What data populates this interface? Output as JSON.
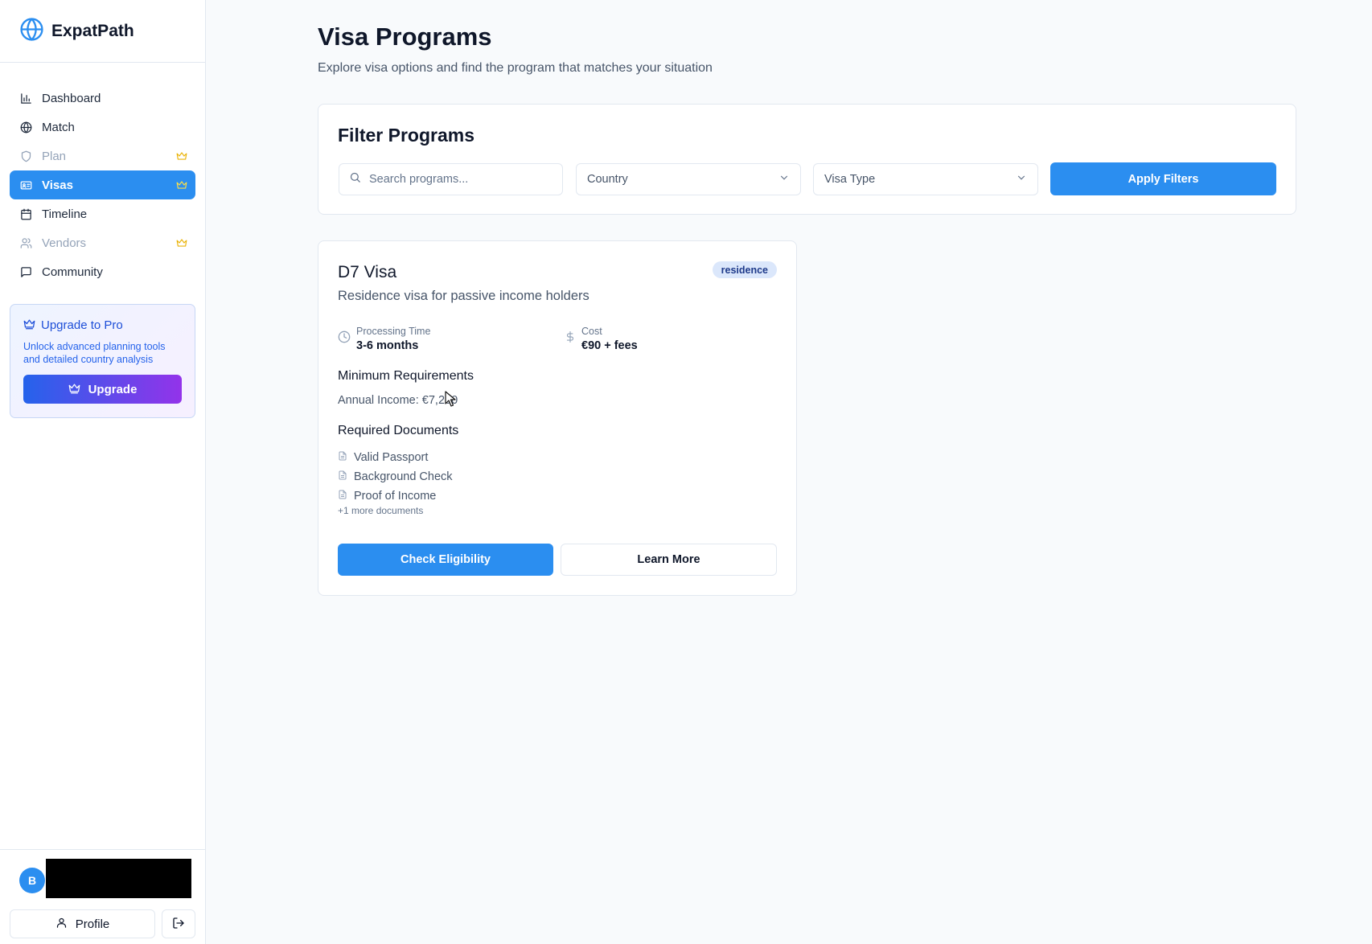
{
  "brand": {
    "name": "ExpatPath",
    "icon": "globe-icon"
  },
  "sidebar": {
    "items": [
      {
        "label": "Dashboard",
        "icon": "bar-chart-icon",
        "state": "normal",
        "premium": false
      },
      {
        "label": "Match",
        "icon": "globe-icon",
        "state": "normal",
        "premium": false
      },
      {
        "label": "Plan",
        "icon": "shield-icon",
        "state": "locked",
        "premium": true
      },
      {
        "label": "Visas",
        "icon": "id-card-icon",
        "state": "active",
        "premium": true
      },
      {
        "label": "Timeline",
        "icon": "calendar-icon",
        "state": "normal",
        "premium": false
      },
      {
        "label": "Vendors",
        "icon": "users-icon",
        "state": "locked",
        "premium": true
      },
      {
        "label": "Community",
        "icon": "message-icon",
        "state": "normal",
        "premium": false
      }
    ],
    "upgrade": {
      "title": "Upgrade to Pro",
      "description": "Unlock advanced planning tools and detailed country analysis",
      "button": "Upgrade"
    },
    "footer": {
      "avatar_initial": "B",
      "profile_label": "Profile"
    }
  },
  "main": {
    "title": "Visa Programs",
    "subtitle": "Explore visa options and find the program that matches your situation",
    "filter": {
      "title": "Filter Programs",
      "search_placeholder": "Search programs...",
      "country_placeholder": "Country",
      "visa_type_placeholder": "Visa Type",
      "apply_label": "Apply Filters"
    },
    "programs": [
      {
        "name": "D7 Visa",
        "badge": "residence",
        "description": "Residence visa for passive income holders",
        "processing_label": "Processing Time",
        "processing_value": "3-6 months",
        "cost_label": "Cost",
        "cost_value": "€90 + fees",
        "requirements_heading": "Minimum Requirements",
        "annual_income": "Annual Income: €7,200",
        "documents_heading": "Required Documents",
        "documents": [
          "Valid Passport",
          "Background Check",
          "Proof of Income"
        ],
        "more_documents": "+1 more documents",
        "check_label": "Check Eligibility",
        "learn_label": "Learn More"
      }
    ]
  },
  "colors": {
    "primary": "#2b8ef0",
    "premium_crown": "#eab308",
    "upgrade_gradient_start": "#2563eb",
    "upgrade_gradient_end": "#9333ea"
  }
}
